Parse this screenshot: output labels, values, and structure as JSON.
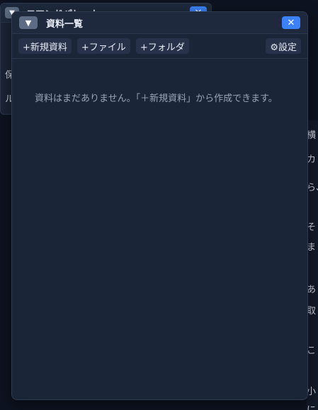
{
  "background_window": {
    "title": "コマンドパレット",
    "toggle_icon": "▼",
    "close_icon": "✕",
    "rows": [
      "保",
      "ル"
    ]
  },
  "right_strip": {
    "fragments": [
      "横",
      "カ",
      "ら、",
      "そ",
      "ま",
      "あ",
      "取",
      "こ",
      "小",
      "に 優"
    ]
  },
  "window": {
    "title": "資料一覧",
    "toggle_icon": "▼",
    "close_icon": "✕"
  },
  "toolbar": {
    "new_document": "+新規資料",
    "file": "+ファイル",
    "folder": "+フォルダ",
    "settings": "⚙設定"
  },
  "content": {
    "empty_message": "資料はまだありません。「＋新規資料」から作成できます。"
  },
  "colors": {
    "accent": "#3b82f6",
    "window_bg": "#1b2538",
    "page_bg": "#0d1320"
  }
}
